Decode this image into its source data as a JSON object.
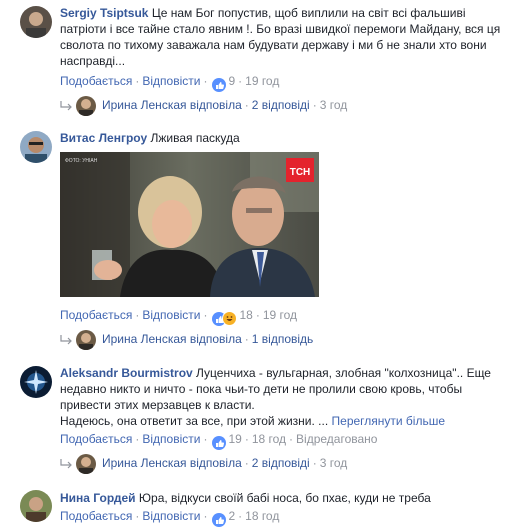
{
  "comments": [
    {
      "author": "Sergiy Tsiptsuk",
      "text": "Це нам Бог попустив, щоб виплили на світ всі фальшиві патріоти і все тайне стало явним !. Бо вразі швидкої перемоги Майдану, вся ця сволота по тихому заважала нам будувати державу і ми б не знали хто вони насправді...",
      "like_label": "Подобається",
      "reply_label": "Відповісти",
      "reaction_count": "9",
      "time": "19 год",
      "reply_author": "Ирина Ленская",
      "reply_verb": "відповіла",
      "reply_count": "2 відповіді",
      "reply_time": "3 год"
    },
    {
      "author": "Витас Ленгроу",
      "text": "Лживая паскуда",
      "photo_caption": "ФОТО: УНІАН",
      "photo_logo": "ТСН",
      "like_label": "Подобається",
      "reply_label": "Відповісти",
      "reaction_count": "18",
      "time": "19 год",
      "reply_author": "Ирина Ленская",
      "reply_verb": "відповіла",
      "reply_count": "1 відповідь"
    },
    {
      "author": "Aleksandr Bourmistrov",
      "text": "Луценчиха - вульгарная, злобная \"колхозница\".. Еще недавно никто и ничто - пока чьи-то дети не пролили свою кровь, чтобы привести этих мерзавцев к власти.",
      "text2": "Надеюсь, она ответит за все, при этой жизни. ...",
      "see_more": "Переглянути більше",
      "like_label": "Подобається",
      "reply_label": "Відповісти",
      "reaction_count": "19",
      "time": "18 год",
      "edited": "Відредаговано",
      "reply_author": "Ирина Ленская",
      "reply_verb": "відповіла",
      "reply_count": "2 відповіді",
      "reply_time": "3 год"
    },
    {
      "author": "Нина Гордей",
      "text": "Юра, відкуси своїй бабі носа, бо пхає, куди не треба",
      "like_label": "Подобається",
      "reply_label": "Відповісти",
      "reaction_count": "2",
      "time": "18 год"
    }
  ],
  "colors": {
    "link": "#4267b2",
    "author": "#365899",
    "meta": "#90949c",
    "like_blue": "#5890ff",
    "haha_yellow": "#f7b125"
  }
}
